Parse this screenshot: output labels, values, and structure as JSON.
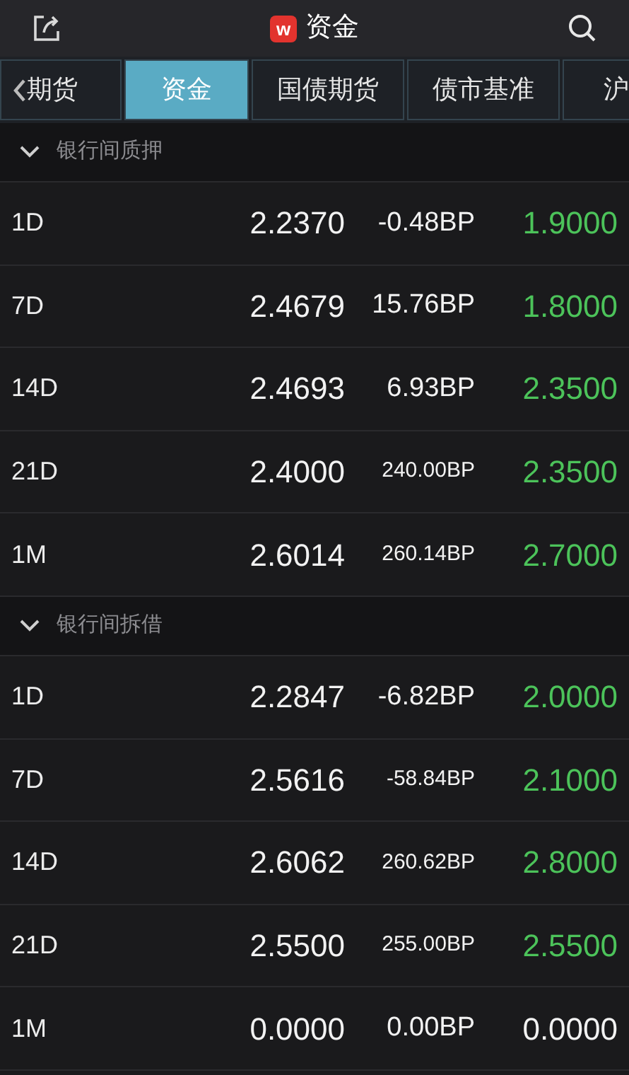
{
  "header": {
    "title": "资金",
    "logo_letter": "w"
  },
  "tabs": [
    {
      "label": "期货",
      "selected": false,
      "back": true
    },
    {
      "label": "资金",
      "selected": true
    },
    {
      "label": "国债期货",
      "selected": false
    },
    {
      "label": "债市基准",
      "selected": false
    },
    {
      "label": "沪",
      "selected": false
    }
  ],
  "sections": [
    {
      "title": "银行间质押",
      "expanded": true,
      "rows": [
        {
          "term": "1D",
          "rate": "2.2370",
          "change": "-0.48BP",
          "last": "1.9000",
          "color": "#4cc35a"
        },
        {
          "term": "7D",
          "rate": "2.4679",
          "change": "15.76BP",
          "last": "1.8000",
          "color": "#4cc35a"
        },
        {
          "term": "14D",
          "rate": "2.4693",
          "change": "6.93BP",
          "last": "2.3500",
          "color": "#4cc35a"
        },
        {
          "term": "21D",
          "rate": "2.4000",
          "change": "240.00BP",
          "last": "2.3500",
          "color": "#4cc35a"
        },
        {
          "term": "1M",
          "rate": "2.6014",
          "change": "260.14BP",
          "last": "2.7000",
          "color": "#4cc35a"
        }
      ]
    },
    {
      "title": "银行间拆借",
      "expanded": true,
      "rows": [
        {
          "term": "1D",
          "rate": "2.2847",
          "change": "-6.82BP",
          "last": "2.0000",
          "color": "#4cc35a"
        },
        {
          "term": "7D",
          "rate": "2.5616",
          "change": "-58.84BP",
          "last": "2.1000",
          "color": "#4cc35a"
        },
        {
          "term": "14D",
          "rate": "2.6062",
          "change": "260.62BP",
          "last": "2.8000",
          "color": "#4cc35a"
        },
        {
          "term": "21D",
          "rate": "2.5500",
          "change": "255.00BP",
          "last": "2.5500",
          "color": "#4cc35a"
        },
        {
          "term": "1M",
          "rate": "0.0000",
          "change": "0.00BP",
          "last": "0.0000",
          "color": "#f2f2f2"
        }
      ]
    }
  ]
}
